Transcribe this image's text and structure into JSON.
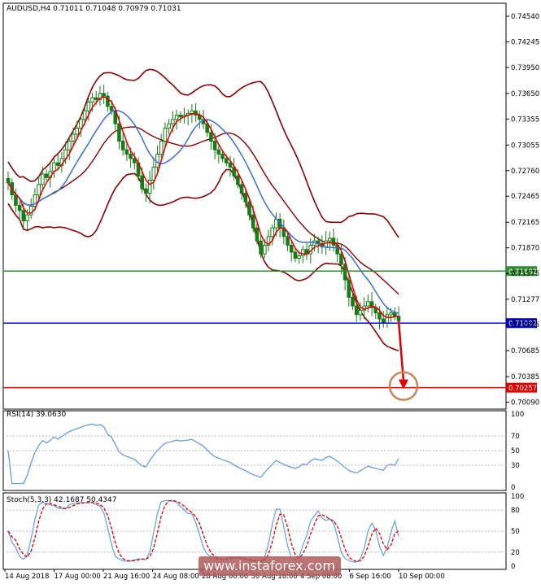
{
  "header": {
    "main": "AUDUSD,H4  0.71011 0.71048 0.70979 0.71031",
    "rsi": "RSI(14) 39.0630",
    "stoch": "Stoch(5,3,3) 42.1687 50.4347"
  },
  "watermark": "www.instaforex.com",
  "colors": {
    "background": "#ffffff",
    "candle": "#1a7a1a",
    "bollinger": "#8b0000",
    "fast_ma": "#e00000",
    "slow_ma": "#3a6fd8",
    "support_green": "#2e8b2e",
    "current_blue": "#0000cc",
    "target_red": "#e00000",
    "rsi_line": "#6a9cdb",
    "stoch_main": "#6aa6e0",
    "stoch_signal": "#e00000",
    "target_circle": "#c8845a",
    "watermark_bg": "#b05a5a"
  },
  "price_axis": {
    "ticks": [
      "0.74540",
      "0.74245",
      "0.73950",
      "0.73650",
      "0.73355",
      "0.73055",
      "0.72760",
      "0.72465",
      "0.72165",
      "0.71870",
      "0.71575",
      "0.71277",
      "0.70985",
      "0.70685",
      "0.70385",
      "0.70090"
    ],
    "range": [
      0.7001,
      0.7469
    ]
  },
  "levels": [
    {
      "name": "resistance",
      "value": 0.71602,
      "label": "0.71602",
      "color": "#2e8b2e"
    },
    {
      "name": "current",
      "value": 0.71002,
      "label": "0.71002",
      "color": "#0000cc"
    },
    {
      "name": "target",
      "value": 0.70257,
      "label": "0.70257",
      "color": "#e00000"
    }
  ],
  "rsi_axis": {
    "ticks": [
      "100",
      "70",
      "50",
      "30",
      "0"
    ],
    "levels": [
      70,
      50,
      30
    ]
  },
  "stoch_axis": {
    "ticks": [
      "100",
      "80",
      "50",
      "20",
      "0"
    ],
    "levels": [
      80,
      50,
      20
    ]
  },
  "time_axis": {
    "labels": [
      "14 Aug 2018",
      "17 Aug 00:00",
      "21 Aug 16:00",
      "24 Aug 08:00",
      "28 Aug 00:00",
      "30 Aug 16:00",
      "4 Sep 08:00",
      "6 Sep 16:00",
      "10 Sep 00:00"
    ]
  },
  "chart_data": {
    "type": "candlestick",
    "symbol": "AUDUSD",
    "timeframe": "H4",
    "close": [
      0.7262,
      0.7248,
      0.7236,
      0.723,
      0.7218,
      0.7225,
      0.7235,
      0.7248,
      0.726,
      0.7272,
      0.7268,
      0.7275,
      0.7285,
      0.7282,
      0.729,
      0.73,
      0.731,
      0.7318,
      0.7325,
      0.7335,
      0.7345,
      0.7355,
      0.736,
      0.7358,
      0.7365,
      0.7362,
      0.735,
      0.7345,
      0.733,
      0.731,
      0.73,
      0.7295,
      0.729,
      0.7285,
      0.727,
      0.7255,
      0.725,
      0.7265,
      0.728,
      0.7295,
      0.731,
      0.7325,
      0.733,
      0.7335,
      0.734,
      0.7338,
      0.734,
      0.7342,
      0.7345,
      0.734,
      0.7335,
      0.733,
      0.732,
      0.731,
      0.73,
      0.7295,
      0.729,
      0.7285,
      0.728,
      0.727,
      0.726,
      0.725,
      0.724,
      0.7225,
      0.721,
      0.7195,
      0.718,
      0.719,
      0.72,
      0.721,
      0.722,
      0.721,
      0.72,
      0.719,
      0.7182,
      0.7175,
      0.7178,
      0.7185,
      0.718,
      0.719,
      0.7195,
      0.7192,
      0.7188,
      0.7195,
      0.7198,
      0.719,
      0.718,
      0.7168,
      0.715,
      0.713,
      0.712,
      0.711,
      0.7115,
      0.712,
      0.7125,
      0.7118,
      0.7112,
      0.7105,
      0.71,
      0.711,
      0.7112,
      0.7108,
      0.7103
    ],
    "ohlc_last": {
      "open": 0.71011,
      "high": 0.71048,
      "low": 0.70979,
      "close": 0.71031
    },
    "indicators": {
      "bollinger": {
        "visible": true
      },
      "moving_averages": [
        "fast red",
        "slow blue"
      ],
      "rsi_last": 39.063,
      "stoch_last": {
        "main": 42.1687,
        "signal": 50.4347
      }
    },
    "forecast": {
      "target": 0.70257
    }
  }
}
